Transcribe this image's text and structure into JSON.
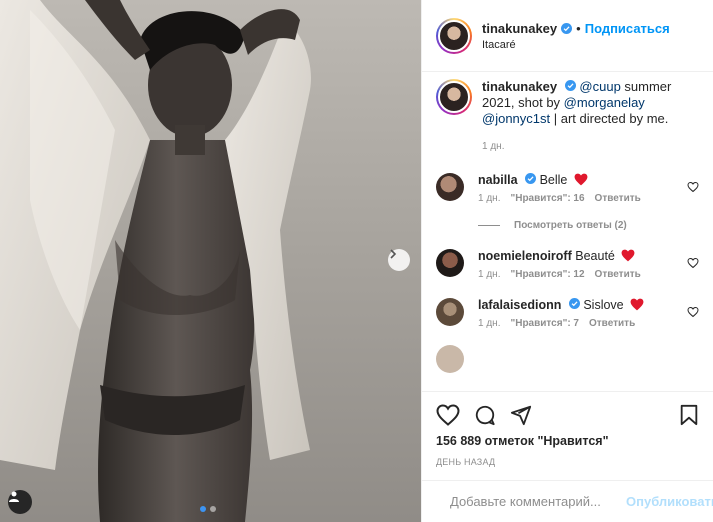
{
  "post": {
    "username": "tinakunakey",
    "follow_label": "Подписаться",
    "separator": "•",
    "location": "Itacaré",
    "caption_mention1": "@cuup",
    "caption_text1": " summer 2021, shot by ",
    "caption_mention2": "@morganelay",
    "caption_space": " ",
    "caption_mention3": "@jonnyc1st",
    "caption_text2": " | art directed by me.",
    "caption_time": "1 дн."
  },
  "comments": [
    {
      "username": "nabilla",
      "text": "Belle",
      "time": "1 дн.",
      "likes": "\"Нравится\": 16",
      "reply": "Ответить",
      "view_replies": "Посмотреть ответы (2)"
    },
    {
      "username": "noemielenoiroff",
      "text": "Beauté",
      "time": "1 дн.",
      "likes": "\"Нравится\": 12",
      "reply": "Ответить"
    },
    {
      "username": "lafalaisedionn",
      "text": "Sislove",
      "time": "1 дн.",
      "likes": "\"Нравится\": 7",
      "reply": "Ответить"
    }
  ],
  "footer": {
    "likes_count": "156 889 отметок \"Нравится\"",
    "date_label": "ДЕНЬ НАЗАД",
    "comment_placeholder": "Добавьте комментарий...",
    "publish_label": "Опубликовать"
  },
  "colors": {
    "accent": "#0095f6",
    "heart": "#ed4956",
    "text": "#262626",
    "muted": "#8e8e8e"
  },
  "carousel": {
    "slides": 2,
    "active": 1
  }
}
